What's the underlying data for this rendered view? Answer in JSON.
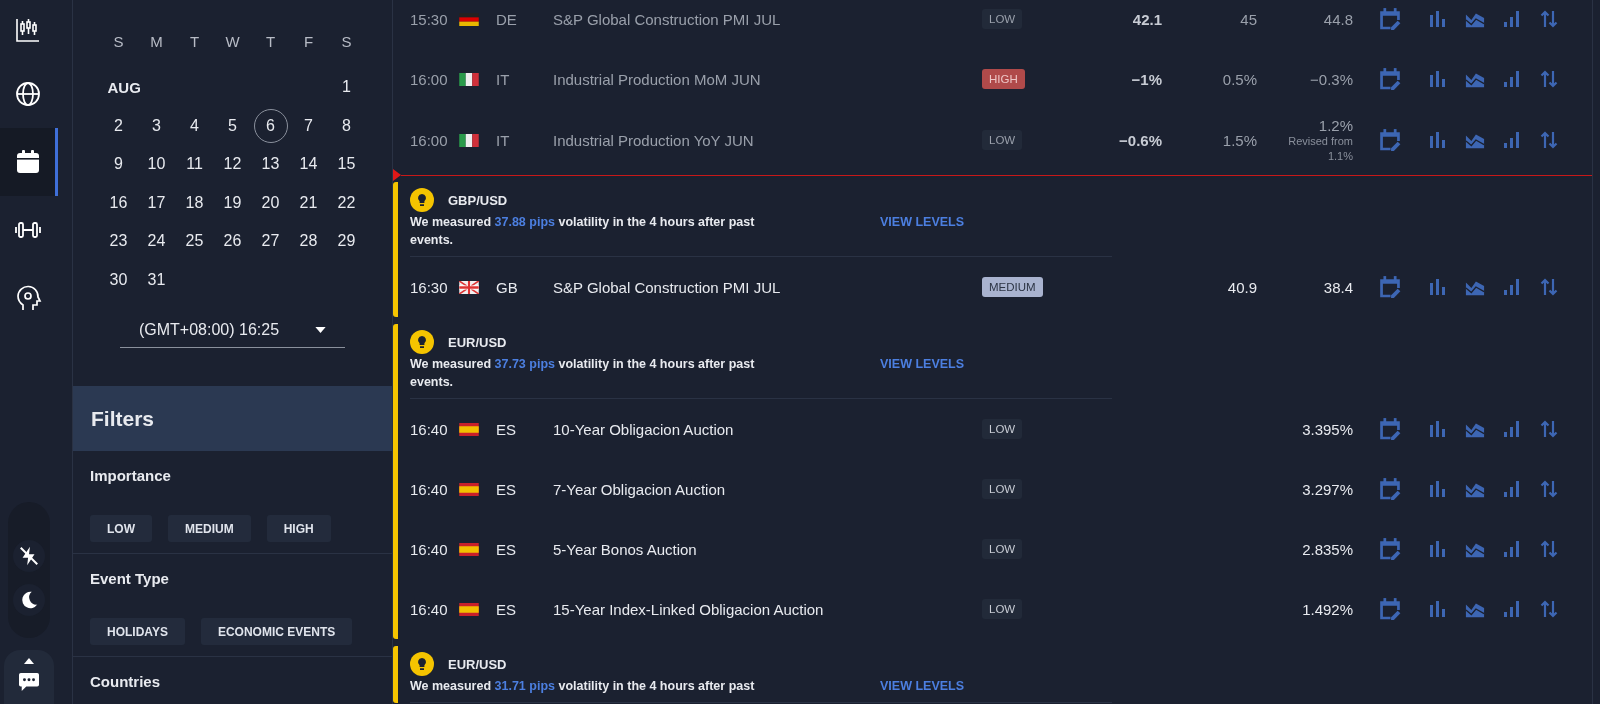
{
  "rail": {
    "items": [
      {
        "kind": "chart",
        "selected": false
      },
      {
        "kind": "globe",
        "selected": false
      },
      {
        "kind": "calendar",
        "selected": true
      },
      {
        "kind": "fitness",
        "selected": false
      },
      {
        "kind": "mind",
        "selected": false
      }
    ]
  },
  "calendar": {
    "weekdays": [
      "S",
      "M",
      "T",
      "W",
      "T",
      "F",
      "S"
    ],
    "weeks": [
      {
        "month": "AUG",
        "days": [
          {
            "label": "1",
            "selected": false
          }
        ]
      },
      {
        "days": [
          {
            "label": "2",
            "selected": false
          },
          {
            "label": "3",
            "selected": false
          },
          {
            "label": "4",
            "selected": false
          },
          {
            "label": "5",
            "selected": false
          },
          {
            "label": "6",
            "selected": true
          },
          {
            "label": "7",
            "selected": false
          },
          {
            "label": "8",
            "selected": false
          }
        ]
      },
      {
        "days": [
          {
            "label": "9",
            "selected": false
          },
          {
            "label": "10",
            "selected": false
          },
          {
            "label": "11",
            "selected": false
          },
          {
            "label": "12",
            "selected": false
          },
          {
            "label": "13",
            "selected": false
          },
          {
            "label": "14",
            "selected": false
          },
          {
            "label": "15",
            "selected": false
          }
        ]
      },
      {
        "days": [
          {
            "label": "16",
            "selected": false
          },
          {
            "label": "17",
            "selected": false
          },
          {
            "label": "18",
            "selected": false
          },
          {
            "label": "19",
            "selected": false
          },
          {
            "label": "20",
            "selected": false
          },
          {
            "label": "21",
            "selected": false
          },
          {
            "label": "22",
            "selected": false
          }
        ]
      },
      {
        "days": [
          {
            "label": "23",
            "selected": false
          },
          {
            "label": "24",
            "selected": false
          },
          {
            "label": "25",
            "selected": false
          },
          {
            "label": "26",
            "selected": false
          },
          {
            "label": "27",
            "selected": false
          },
          {
            "label": "28",
            "selected": false
          },
          {
            "label": "29",
            "selected": false
          }
        ]
      },
      {
        "days": [
          {
            "label": "30",
            "selected": false
          },
          {
            "label": "31",
            "selected": false
          }
        ]
      }
    ],
    "timezone": "(GMT+08:00) 16:25"
  },
  "filters": {
    "title": "Filters",
    "sections": [
      {
        "title": "Importance",
        "chips": [
          {
            "label": "LOW",
            "selected": false
          },
          {
            "label": "MEDIUM",
            "selected": false
          },
          {
            "label": "HIGH",
            "selected": false
          }
        ]
      },
      {
        "title": "Event Type",
        "chips": [
          {
            "label": "HOLIDAYS",
            "selected": false
          },
          {
            "label": "ECONOMIC EVENTS",
            "selected": false
          }
        ]
      },
      {
        "title": "Countries"
      }
    ]
  },
  "groups": [
    {
      "kind": "past",
      "events": [
        {
          "time": "15:30",
          "flag": {
            "kind": "de"
          },
          "country": "DE",
          "title": "S&P Global Construction PMI JUL",
          "importance": {
            "label": "LOW",
            "kind": "low"
          },
          "actual": "42.1",
          "forecast": "45",
          "previous": "44.8"
        },
        {
          "time": "16:00",
          "flag": {
            "kind": "it"
          },
          "country": "IT",
          "title": "Industrial Production MoM JUN",
          "importance": {
            "label": "HIGH",
            "kind": "high"
          },
          "actual": "−1%",
          "forecast": "0.5%",
          "previous": "−0.3%"
        },
        {
          "time": "16:00",
          "flag": {
            "kind": "it"
          },
          "country": "IT",
          "title": "Industrial Production YoY JUN",
          "importance": {
            "label": "LOW",
            "kind": "low"
          },
          "actual": "−0.6%",
          "forecast": "1.5%",
          "previous": "1.2%",
          "revised": "Revised from 1.1%"
        }
      ]
    },
    {
      "kind": "volatility",
      "pair": "GBP/USD",
      "message_lead": "We measured",
      "pips": "37.88 pips",
      "message_tail": "volatility in the 4 hours after past events.",
      "link": "VIEW LEVELS",
      "events": [
        {
          "time": "16:30",
          "flag": {
            "kind": "gb"
          },
          "country": "GB",
          "title": "S&P Global Construction PMI JUL",
          "importance": {
            "label": "MEDIUM",
            "kind": "medium"
          },
          "forecast": "40.9",
          "previous": "38.4"
        }
      ]
    },
    {
      "kind": "volatility",
      "pair": "EUR/USD",
      "message_lead": "We measured",
      "pips": "37.73 pips",
      "message_tail": "volatility in the 4 hours after past events.",
      "link": "VIEW LEVELS",
      "events": [
        {
          "time": "16:40",
          "flag": {
            "kind": "es"
          },
          "country": "ES",
          "title": "10-Year Obligacion Auction",
          "importance": {
            "label": "LOW",
            "kind": "low"
          },
          "previous": "3.395%"
        },
        {
          "time": "16:40",
          "flag": {
            "kind": "es"
          },
          "country": "ES",
          "title": "7-Year Obligacion Auction",
          "importance": {
            "label": "LOW",
            "kind": "low"
          },
          "previous": "3.297%"
        },
        {
          "time": "16:40",
          "flag": {
            "kind": "es"
          },
          "country": "ES",
          "title": "5-Year Bonos Auction",
          "importance": {
            "label": "LOW",
            "kind": "low"
          },
          "previous": "2.835%"
        },
        {
          "time": "16:40",
          "flag": {
            "kind": "es"
          },
          "country": "ES",
          "title": "15-Year Index-Linked Obligacion Auction",
          "importance": {
            "label": "LOW",
            "kind": "low"
          },
          "previous": "1.492%"
        }
      ]
    },
    {
      "kind": "volatility",
      "pair": "EUR/USD",
      "message_lead": "We measured",
      "pips": "31.71 pips",
      "message_tail": "volatility in the 4 hours after past",
      "link": "VIEW LEVELS"
    }
  ]
}
